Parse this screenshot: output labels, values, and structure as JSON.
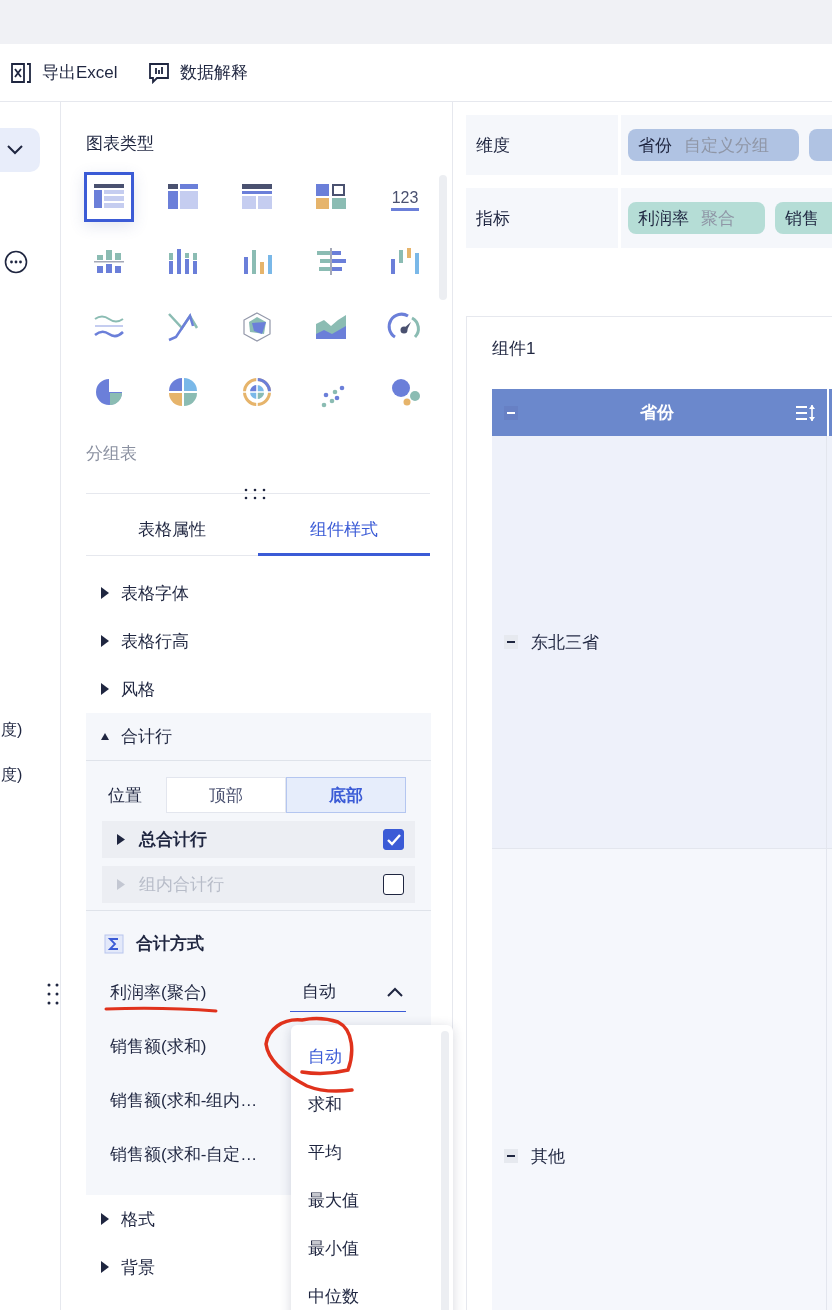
{
  "toolbar": [
    {
      "kind": "excel",
      "label": "导出Excel"
    },
    {
      "kind": "explain",
      "label": "数据解释"
    }
  ],
  "left_strip": {
    "texts": [
      "度)",
      "度)"
    ]
  },
  "chart_types": {
    "title": "图表类型",
    "current": "分组表",
    "types": [
      {
        "selected": true
      },
      {
        "selected": false
      },
      {
        "selected": false
      },
      {
        "selected": false
      },
      {
        "selected": false,
        "text": "123"
      },
      {
        "selected": false
      },
      {
        "selected": false
      },
      {
        "selected": false
      },
      {
        "selected": false
      },
      {
        "selected": false
      },
      {
        "selected": false
      },
      {
        "selected": false
      },
      {
        "selected": false
      },
      {
        "selected": false
      },
      {
        "selected": false
      },
      {
        "selected": false
      },
      {
        "selected": false
      },
      {
        "selected": false
      },
      {
        "selected": false
      },
      {
        "selected": false
      }
    ]
  },
  "tabs": [
    {
      "label": "表格属性",
      "selected": false
    },
    {
      "label": "组件样式",
      "selected": true
    }
  ],
  "sections": [
    {
      "label": "表格字体",
      "expanded": false
    },
    {
      "label": "表格行高",
      "expanded": false
    },
    {
      "label": "风格",
      "expanded": false
    },
    {
      "label": "合计行",
      "expanded": true,
      "content": {
        "position": {
          "label": "位置",
          "options": [
            {
              "label": "顶部",
              "selected": false
            },
            {
              "label": "底部",
              "selected": true
            }
          ]
        },
        "sub_rows": [
          {
            "label": "总合计行",
            "checked": true,
            "disabled": false
          },
          {
            "label": "组内合计行",
            "checked": false,
            "disabled": true
          }
        ],
        "summary": {
          "title": "合计方式",
          "rows": [
            {
              "label": "利润率(聚合)",
              "value": "自动",
              "open": true
            },
            {
              "label": "销售额(求和)"
            },
            {
              "label": "销售额(求和-组内…"
            },
            {
              "label": "销售额(求和-自定…"
            }
          ]
        },
        "dropdown": [
          {
            "label": "自动",
            "selected": true
          },
          {
            "label": "求和",
            "selected": false
          },
          {
            "label": "平均",
            "selected": false
          },
          {
            "label": "最大值",
            "selected": false
          },
          {
            "label": "最小值",
            "selected": false
          },
          {
            "label": "中位数",
            "selected": false
          }
        ]
      }
    },
    {
      "label": "格式",
      "expanded": false
    },
    {
      "label": "背景",
      "expanded": false
    }
  ],
  "fields": [
    {
      "label": "维度",
      "chips": [
        {
          "kind": "dimension",
          "name": "省份",
          "note": "自定义分组"
        },
        {
          "kind": "dimension"
        }
      ]
    },
    {
      "label": "指标",
      "chips": [
        {
          "kind": "measure",
          "name": "利润率",
          "note": "聚合"
        },
        {
          "kind": "measure",
          "name": "销售"
        }
      ]
    }
  ],
  "table": {
    "title": "组件1",
    "columns": [
      {
        "label": "省份"
      }
    ],
    "rows": [
      {
        "label": "东北三省"
      },
      {
        "label": "其他"
      }
    ]
  }
}
